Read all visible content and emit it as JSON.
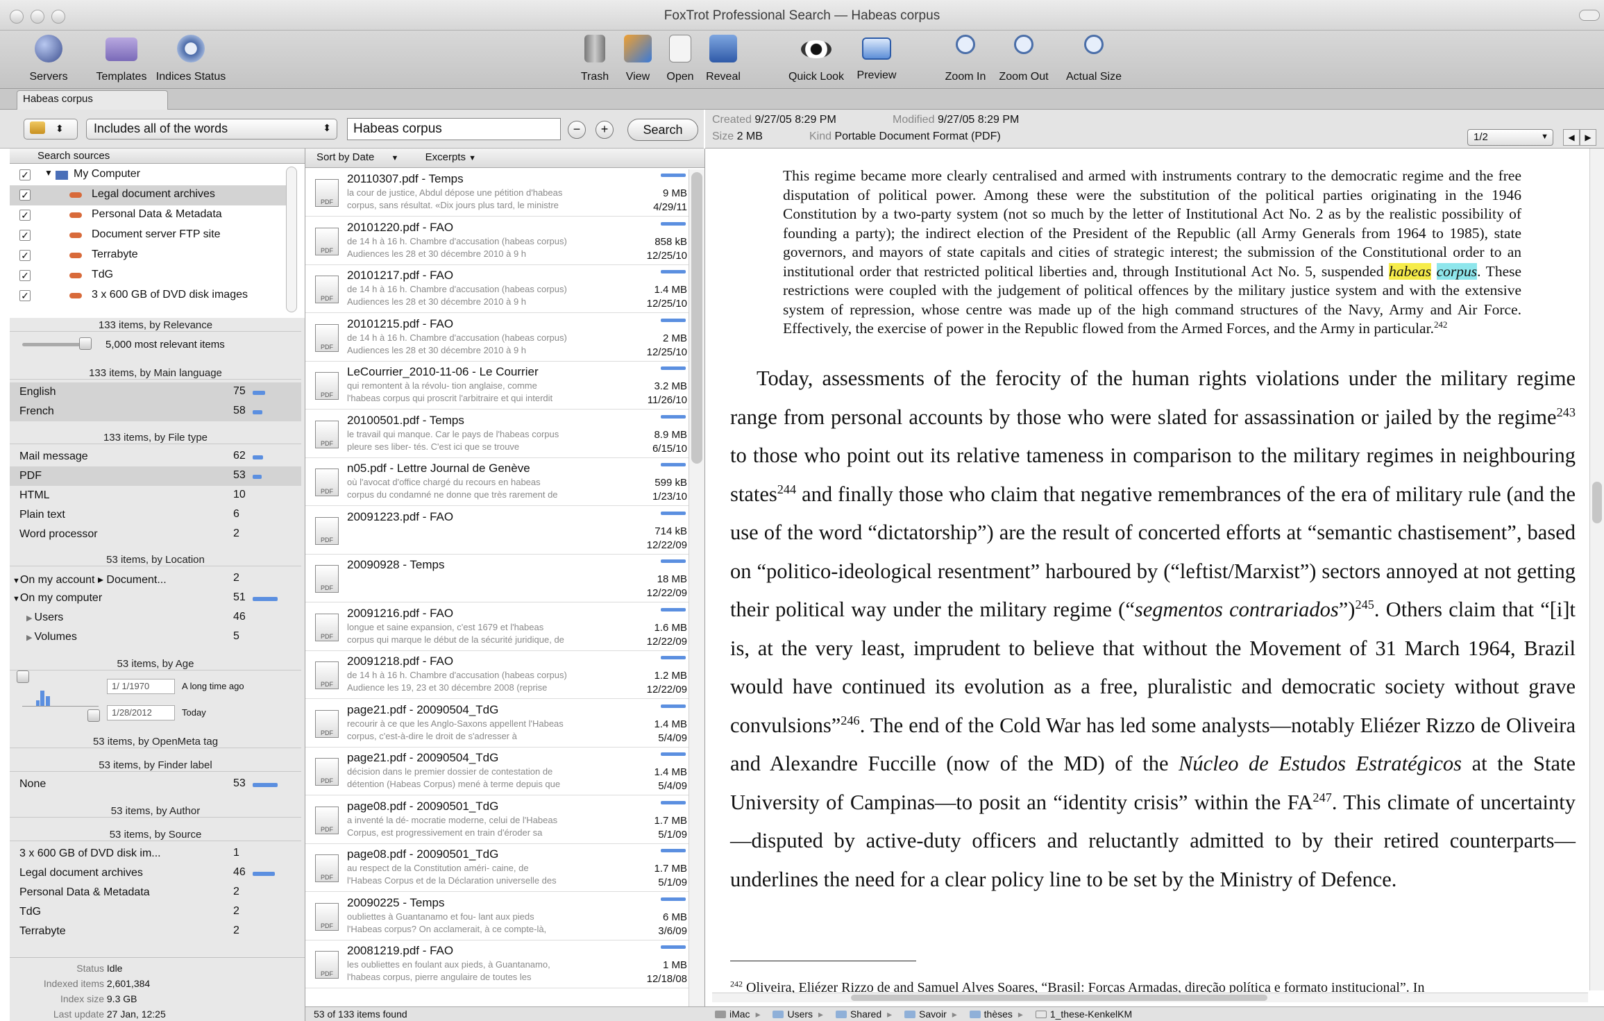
{
  "window": {
    "title": "FoxTrot Professional Search — Habeas corpus"
  },
  "toolbar": {
    "left": [
      {
        "label": "Servers",
        "icon": "globe-icon"
      },
      {
        "label": "Templates",
        "icon": "folder-icon"
      },
      {
        "label": "Indices Status",
        "icon": "gear-icon"
      }
    ],
    "center": [
      {
        "label": "Trash",
        "icon": "trash-icon"
      },
      {
        "label": "View",
        "icon": "view-icon"
      },
      {
        "label": "Open",
        "icon": "open-icon"
      },
      {
        "label": "Reveal",
        "icon": "reveal-icon"
      },
      {
        "label": "Quick Look",
        "icon": "eye-icon"
      },
      {
        "label": "Preview",
        "icon": "preview-icon"
      },
      {
        "label": "Zoom In",
        "icon": "zoom-in-icon"
      },
      {
        "label": "Zoom Out",
        "icon": "zoom-out-icon"
      },
      {
        "label": "Actual Size",
        "icon": "actual-size-icon"
      }
    ]
  },
  "tab": {
    "label": "Habeas corpus"
  },
  "search": {
    "mode": "Includes all of the words",
    "query": "Habeas corpus",
    "button": "Search",
    "minus": "−",
    "plus": "+"
  },
  "sources": {
    "header": "Search sources",
    "items": [
      "My Computer",
      "Legal document archives",
      "Personal Data & Metadata",
      "Document server FTP site",
      "Terrabyte",
      "TdG",
      "3 x 600 GB of DVD disk images"
    ]
  },
  "facets": {
    "relevance": {
      "title": "133 items, by Relevance",
      "slider_label": "5,000 most relevant items"
    },
    "language": {
      "title": "133 items, by Main language",
      "rows": [
        {
          "label": "English",
          "count": "75"
        },
        {
          "label": "French",
          "count": "58"
        }
      ]
    },
    "filetype": {
      "title": "133 items, by File type",
      "rows": [
        {
          "label": "Mail message",
          "count": "62"
        },
        {
          "label": "PDF",
          "count": "53"
        },
        {
          "label": "HTML",
          "count": "10"
        },
        {
          "label": "Plain text",
          "count": "6"
        },
        {
          "label": "Word processor",
          "count": "2"
        }
      ]
    },
    "location": {
      "title": "53 items, by Location",
      "rows": [
        {
          "label": "On my account ▸ Document...",
          "count": "2"
        },
        {
          "label": "On my computer",
          "count": "51"
        },
        {
          "label": "Users",
          "count": "46"
        },
        {
          "label": "Volumes",
          "count": "5"
        }
      ]
    },
    "age": {
      "title": "53 items, by Age",
      "from": "1/ 1/1970",
      "from_label": "A long time ago",
      "to": "1/28/2012",
      "to_label": "Today"
    },
    "openmeta": {
      "title": "53 items, by OpenMeta tag"
    },
    "finder": {
      "title": "53 items, by Finder label",
      "rows": [
        {
          "label": "None",
          "count": "53"
        }
      ]
    },
    "author": {
      "title": "53 items, by Author"
    },
    "source": {
      "title": "53 items, by Source",
      "rows": [
        {
          "label": "3 x 600 GB of DVD disk im...",
          "count": "1"
        },
        {
          "label": "Legal document archives",
          "count": "46"
        },
        {
          "label": "Personal Data & Metadata",
          "count": "2"
        },
        {
          "label": "TdG",
          "count": "2"
        },
        {
          "label": "Terrabyte",
          "count": "2"
        }
      ]
    }
  },
  "status": {
    "status_label": "Status",
    "status_value": "Idle",
    "indexed_label": "Indexed items",
    "indexed_value": "2,601,384",
    "size_label": "Index size",
    "size_value": "9.3 GB",
    "update_label": "Last update",
    "update_value": "27 Jan, 12:25"
  },
  "results": {
    "sort_label": "Sort by Date",
    "excerpts_label": "Excerpts",
    "count_text": "53 of 133 items found",
    "items": [
      {
        "title": "20110307.pdf - Temps",
        "ex1": "la cour de justice, Abdul dépose une pétition d'habeas",
        "ex2": "corpus, sans résultat. «Dix jours plus tard, le ministre",
        "size": "9 MB",
        "date": "4/29/11"
      },
      {
        "title": "20101220.pdf - FAO",
        "ex1": "de 14 h à 16 h. Chambre d'accusation (habeas corpus)",
        "ex2": "Audiences les 28 et 30 décembre 2010 à 9 h",
        "size": "858 kB",
        "date": "12/25/10"
      },
      {
        "title": "20101217.pdf - FAO",
        "ex1": "de 14 h à 16 h. Chambre d'accusation (habeas corpus)",
        "ex2": "Audiences les 28 et 30 décembre 2010 à 9 h",
        "size": "1.4 MB",
        "date": "12/25/10"
      },
      {
        "title": "20101215.pdf - FAO",
        "ex1": "de 14 h à 16 h. Chambre d'accusation (habeas corpus)",
        "ex2": "Audiences les 28 et 30 décembre 2010 à 9 h",
        "size": "2 MB",
        "date": "12/25/10"
      },
      {
        "title": "LeCourrier_2010-11-06 - Le Courrier",
        "ex1": "qui remontent à la révolu- tion anglaise, comme",
        "ex2": "l'habeas corpus qui proscrit l'arbitraire et qui interdit",
        "size": "3.2 MB",
        "date": "11/26/10"
      },
      {
        "title": "20100501.pdf - Temps",
        "ex1": "le travail qui manque. Car le pays de l'habeas corpus",
        "ex2": "pleure ses liber- tés. C'est ici que se trouve",
        "size": "8.9 MB",
        "date": "6/15/10"
      },
      {
        "title": "n05.pdf - Lettre Journal de Genève",
        "ex1": "où l'avocat d'office chargé du recours en habeas",
        "ex2": "corpus du condamné ne donne que très rarement de",
        "size": "599 kB",
        "date": "1/23/10"
      },
      {
        "title": "20091223.pdf - FAO",
        "ex1": "",
        "ex2": "",
        "size": "714 kB",
        "date": "12/22/09"
      },
      {
        "title": "20090928 - Temps",
        "ex1": "",
        "ex2": "",
        "size": "18 MB",
        "date": "12/22/09"
      },
      {
        "title": "20091216.pdf - FAO",
        "ex1": "longue et saine expansion, c'est 1679 et l'habeas",
        "ex2": "corpus qui marque le début de la sécurité juridique, de",
        "size": "1.6 MB",
        "date": "12/22/09"
      },
      {
        "title": "20091218.pdf - FAO",
        "ex1": "de 14 h à 16 h. Chambre d'accusation (habeas corpus)",
        "ex2": "Audience les 19, 23 et 30 décembre 2008 (reprise",
        "size": "1.2 MB",
        "date": "12/22/09"
      },
      {
        "title": "page21.pdf - 20090504_TdG",
        "ex1": "recourir à ce que les Anglo-Saxons appellent l'Habeas",
        "ex2": "corpus, c'est-à-dire le droit de s'adresser à",
        "size": "1.4 MB",
        "date": "5/4/09"
      },
      {
        "title": "page21.pdf - 20090504_TdG",
        "ex1": "décision dans le premier dossier de contestation de",
        "ex2": "détention (Habeas Corpus) mené à terme depuis que",
        "size": "1.4 MB",
        "date": "5/4/09"
      },
      {
        "title": "page08.pdf - 20090501_TdG",
        "ex1": "a inventé la dé- mocratie moderne, celui de l'Habeas",
        "ex2": "Corpus, est progressivement en train d'éroder sa",
        "size": "1.7 MB",
        "date": "5/1/09"
      },
      {
        "title": "page08.pdf - 20090501_TdG",
        "ex1": "au respect de la Constitution améri- caine, de",
        "ex2": "l'Habeas Corpus et de la Déclaration universelle des",
        "size": "1.7 MB",
        "date": "5/1/09"
      },
      {
        "title": "20090225 - Temps",
        "ex1": "oubliettes à Guantanamo et fou- lant aux pieds",
        "ex2": "l'Habeas corpus? On acclamerait, à ce compte-là,",
        "size": "6 MB",
        "date": "3/6/09"
      },
      {
        "title": "20081219.pdf - FAO",
        "ex1": "les oubliettes en foulant aux pieds, à Guantanamo,",
        "ex2": "l'habeas corpus, pierre angulaire de toutes les",
        "size": "1 MB",
        "date": "12/18/08"
      }
    ]
  },
  "preview": {
    "created_label": "Created",
    "created_value": "9/27/05 8:29 PM",
    "modified_label": "Modified",
    "modified_value": "9/27/05 8:29 PM",
    "size_label": "Size",
    "size_value": "2 MB",
    "kind_label": "Kind",
    "kind_value": "Portable Document Format (PDF)",
    "page": "1/2",
    "quote": {
      "p1": "This regime became more clearly centralised and armed with instruments contrary to the democratic regime and the free disputation of political power. Among these were the substitution of the political parties originating in the 1946 Constitution by a two-party system (not so much by the letter of Institutional Act No. 2 as by the realistic possibility of founding a party); the indirect election of the President of the Republic (all Army Generals from 1964 to 1985), state governors, and mayors of state capitals and cities of strategic interest; the submission of the Constitutional order to an institutional order that restricted political liberties and, through Institutional Act No. 5, suspended",
      "hl1": "habeas",
      "hl2": "corpus",
      "p2": ". These restrictions were coupled with the judgement of political offences by the military justice system and with the extensive system of repression, whose centre was made up of the high command structures of the Navy, Army and Air Force. Effectively, the exercise of power in the Republic flowed from the Armed Forces, and the Army in particular.",
      "n": "242"
    },
    "body": {
      "s1": "Today, assessments of the ferocity of the human rights violations under the military regime range from personal accounts by those who were slated for assassination or jailed by the regime",
      "n243": "243",
      "s2": " to those who point out its relative tameness in comparison to the military regimes in neighbouring states",
      "n244": "244",
      "s3": " and finally those who claim that negative remembrances of the era of military rule (and the use of the word “dictatorship”) are the result of concerted efforts at “semantic chastisement”, based on “politico-ideological resentment” harboured by (“leftist/Marxist”) sectors annoyed at not getting their political way under the military regime (“",
      "it1": "segmentos contrariados",
      "s4": "”)",
      "n245": "245",
      "s5": ". Others claim that “[i]t is, at the very least, imprudent to believe that without the Movement of 31 March 1964, Brazil would have continued its evolution as a free, pluralistic and democratic society without grave convulsions”",
      "n246": "246",
      "s6": ". The end of the Cold War has led some analysts—notably Eliézer Rizzo de Oliveira and Alexandre Fuccille (now of the MD) of the ",
      "it2": "Núcleo de Estudos Estratégicos",
      "s7": " at the State University of Campinas—to posit an “identity crisis” within the FA",
      "n247": "247",
      "s8": ". This climate of uncertainty—disputed by active-duty officers and reluctantly admitted to by their retired counterparts—underlines the need for a clear policy line to be set by the Ministry of Defence."
    },
    "footnote": {
      "n": "242",
      "text": " Oliveira, Eliézer Rizzo de and Samuel Alves Soares, “Brasil: Forças Armadas, direção política e formato institucional”. In"
    },
    "path": [
      "iMac",
      "Users",
      "Shared",
      "Savoir",
      "thèses",
      "1_these-KenkelKM"
    ]
  }
}
